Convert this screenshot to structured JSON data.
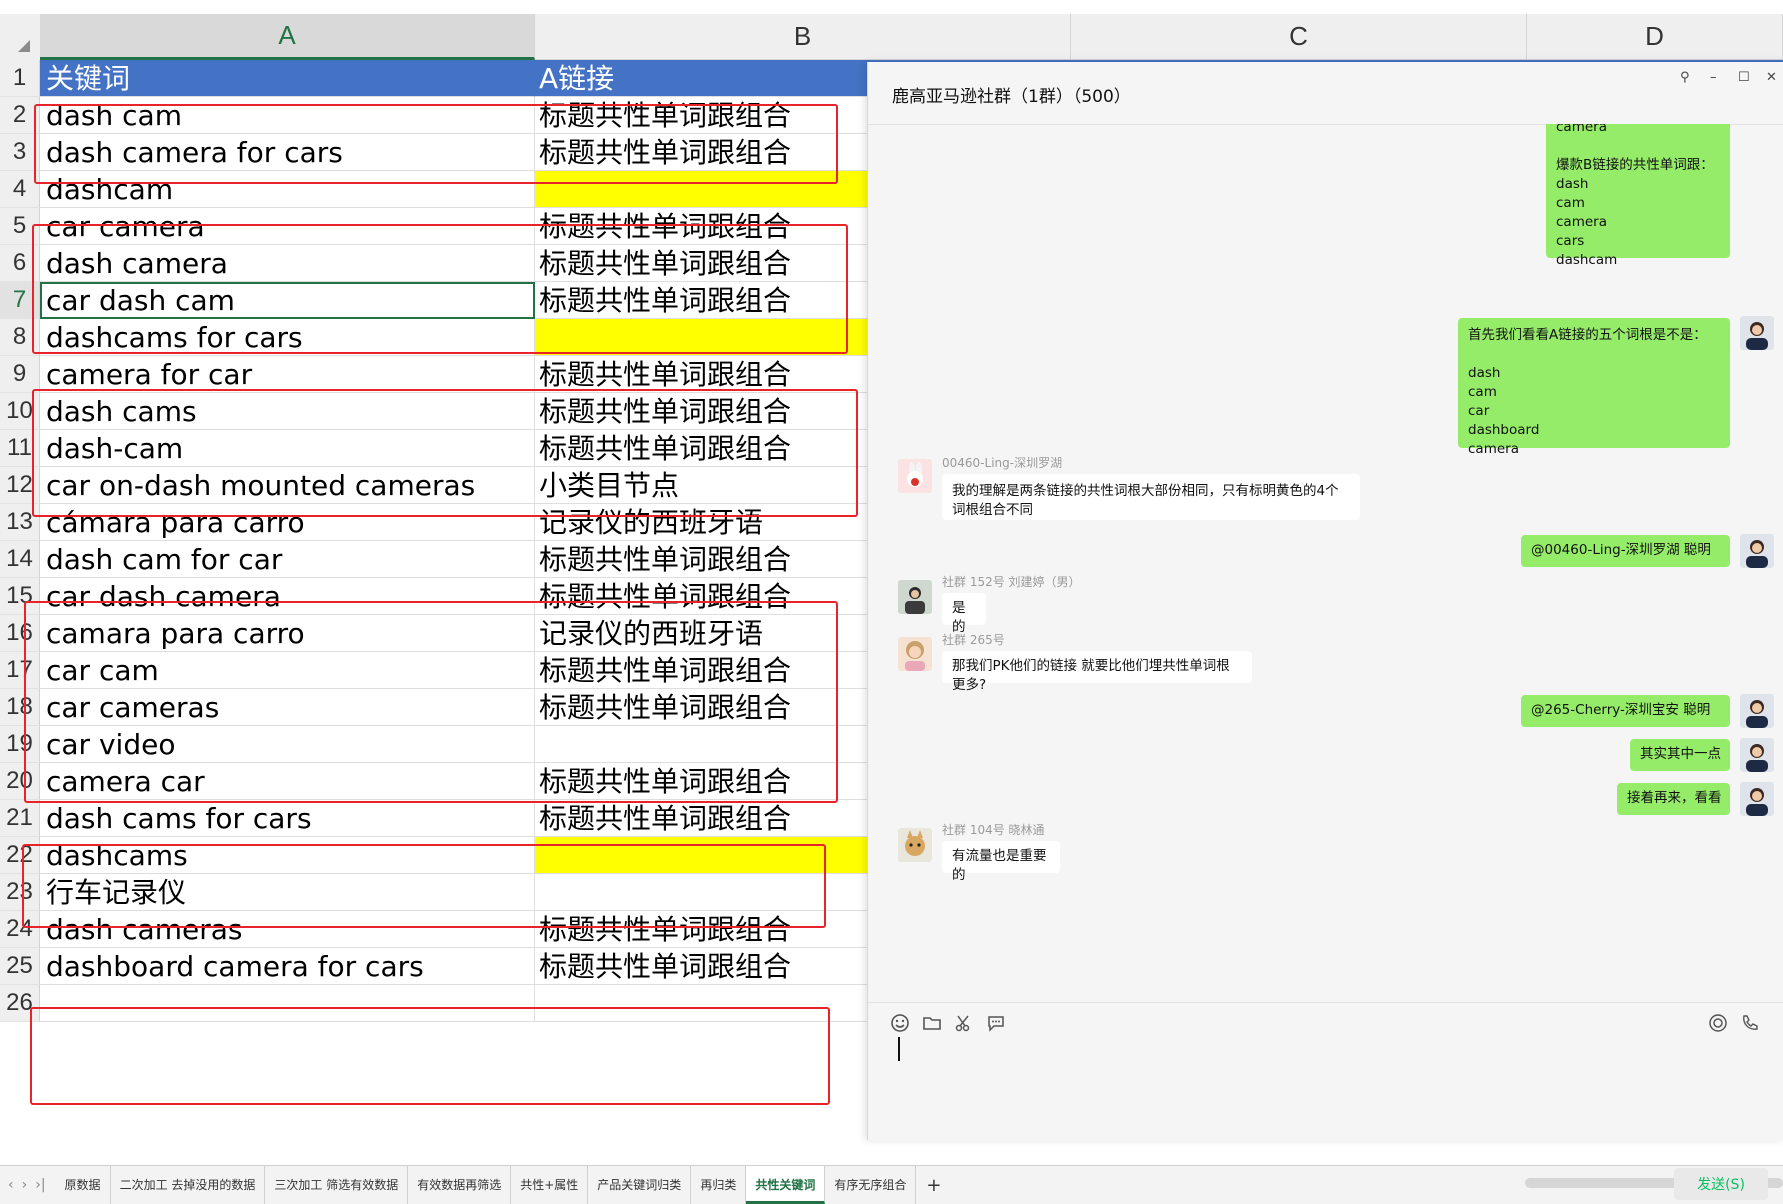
{
  "spreadsheet": {
    "columns": [
      "A",
      "B",
      "C",
      "D"
    ],
    "selected_column": "A",
    "selected_row": 7,
    "rows": [
      {
        "num": "1",
        "a": "关键词",
        "b": "A链接",
        "header": true
      },
      {
        "num": "2",
        "a": "dash cam",
        "b": "标题共性单词跟组合"
      },
      {
        "num": "3",
        "a": "dash camera for cars",
        "b": "标题共性单词跟组合"
      },
      {
        "num": "4",
        "a": "dashcam",
        "b": "",
        "yellow": true
      },
      {
        "num": "5",
        "a": "car camera",
        "b": "标题共性单词跟组合"
      },
      {
        "num": "6",
        "a": "dash camera",
        "b": "标题共性单词跟组合"
      },
      {
        "num": "7",
        "a": "car dash cam",
        "b": "标题共性单词跟组合",
        "active": true
      },
      {
        "num": "8",
        "a": "dashcams for cars",
        "b": "",
        "yellow": true
      },
      {
        "num": "9",
        "a": "camera for car",
        "b": "标题共性单词跟组合"
      },
      {
        "num": "10",
        "a": "dash cams",
        "b": "标题共性单词跟组合"
      },
      {
        "num": "11",
        "a": "dash-cam",
        "b": "标题共性单词跟组合"
      },
      {
        "num": "12",
        "a": "car on-dash mounted cameras",
        "b": "小类目节点"
      },
      {
        "num": "13",
        "a": "cámara para carro",
        "b": "记录仪的西班牙语"
      },
      {
        "num": "14",
        "a": "dash cam for car",
        "b": "标题共性单词跟组合"
      },
      {
        "num": "15",
        "a": "car dash camera",
        "b": "标题共性单词跟组合"
      },
      {
        "num": "16",
        "a": "camara para carro",
        "b": "记录仪的西班牙语"
      },
      {
        "num": "17",
        "a": "car cam",
        "b": "标题共性单词跟组合"
      },
      {
        "num": "18",
        "a": "car cameras",
        "b": "标题共性单词跟组合"
      },
      {
        "num": "19",
        "a": "car video",
        "b": ""
      },
      {
        "num": "20",
        "a": "camera car",
        "b": "标题共性单词跟组合"
      },
      {
        "num": "21",
        "a": "dash cams for cars",
        "b": "标题共性单词跟组合"
      },
      {
        "num": "22",
        "a": "dashcams",
        "b": "",
        "yellow": true
      },
      {
        "num": "23",
        "a": "行车记录仪",
        "b": ""
      },
      {
        "num": "24",
        "a": "dash cameras",
        "b": "标题共性单词跟组合"
      },
      {
        "num": "25",
        "a": "dashboard camera for cars",
        "b": "标题共性单词跟组合"
      },
      {
        "num": "26",
        "a": "",
        "b": ""
      }
    ],
    "header_color": "#4472c4",
    "highlight_color": "#ffff00",
    "annotation_color": "#e8232a"
  },
  "sheet_tabs": {
    "items": [
      "原数据",
      "二次加工 去掉没用的数据",
      "三次加工 筛选有效数据",
      "有效数据再筛选",
      "共性+属性",
      "产品关键词归类",
      "再归类",
      "共性关键词",
      "有序无序组合"
    ],
    "active": "共性关键词",
    "add_label": "+",
    "nav": [
      "‹",
      "›",
      "›|"
    ]
  },
  "chat": {
    "title": "鹿高亚马逊社群（1群）（500）",
    "window_controls": [
      "⚲",
      "–",
      "☐",
      "✕"
    ],
    "messages": [
      {
        "side": "right",
        "text": "camera\n\n爆款B链接的共性单词跟：\ndash\ncam\ncamera\ncars\ndashcam"
      },
      {
        "side": "right",
        "text": "首先我们看看A链接的五个词根是不是：\n\ndash\ncam\ncar\ndashboard\ncamera"
      },
      {
        "side": "left",
        "sender": "00460-Ling-深圳罗湖",
        "text": "我的理解是两条链接的共性词根大部份相同，只有标明黄色的4个词根组合不同"
      },
      {
        "side": "right",
        "text": "@00460-Ling-深圳罗湖 聪明"
      },
      {
        "side": "left",
        "sender": "社群 152号 刘建婷（男）",
        "text": "是的"
      },
      {
        "side": "left",
        "sender": "社群 265号",
        "text": "那我们PK他们的链接 就要比他们埋共性单词根更多?"
      },
      {
        "side": "right",
        "text": "@265-Cherry-深圳宝安 聪明"
      },
      {
        "side": "right",
        "text": "其实其中一点"
      },
      {
        "side": "right",
        "text": "接着再来，看看"
      },
      {
        "side": "left",
        "sender": "社群 104号 晓林通",
        "text": "有流量也是重要的"
      }
    ],
    "toolbar_icons": [
      "emoji-icon",
      "folder-icon",
      "scissors-icon",
      "chat-history-icon",
      "live-icon",
      "phone-icon"
    ],
    "send_label": "发送(S)",
    "bubble_color": "#95ec69"
  }
}
